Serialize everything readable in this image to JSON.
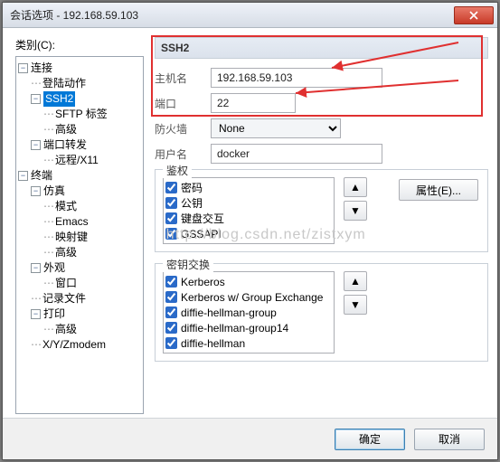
{
  "window": {
    "title": "会话选项 - 192.168.59.103"
  },
  "leftPanel": {
    "categoryLabel": "类别(C):",
    "tree": {
      "n0": "连接",
      "n1": "登陆动作",
      "n2": "SSH2",
      "n3": "SFTP 标签",
      "n4": "高级",
      "n5": "端口转发",
      "n6": "远程/X11",
      "n7": "终端",
      "n8": "仿真",
      "n9": "模式",
      "n10": "Emacs",
      "n11": "映射键",
      "n12": "高级",
      "n13": "外观",
      "n14": "窗口",
      "n15": "记录文件",
      "n16": "打印",
      "n17": "高级",
      "n18": "X/Y/Zmodem"
    }
  },
  "panel": {
    "header": "SSH2",
    "host_label": "主机名",
    "host_value": "192.168.59.103",
    "port_label": "端口",
    "port_value": "22",
    "firewall_label": "防火墙",
    "firewall_value": "None",
    "user_label": "用户名",
    "user_value": "docker"
  },
  "auth": {
    "title": "鉴权",
    "items": {
      "i0": "密码",
      "i1": "公钥",
      "i2": "键盘交互",
      "i3": "GSSAPI"
    },
    "props_btn": "属性(E)..."
  },
  "kex": {
    "title": "密钥交换",
    "items": {
      "i0": "Kerberos",
      "i1": "Kerberos w/ Group Exchange",
      "i2": "diffie-hellman-group",
      "i3": "diffie-hellman-group14",
      "i4": "diffie-hellman"
    }
  },
  "footer": {
    "ok": "确定",
    "cancel": "取消"
  },
  "glyphs": {
    "up": "▲",
    "down": "▼",
    "minus": "−"
  },
  "watermark": "http://blog.csdn.net/zistxym"
}
